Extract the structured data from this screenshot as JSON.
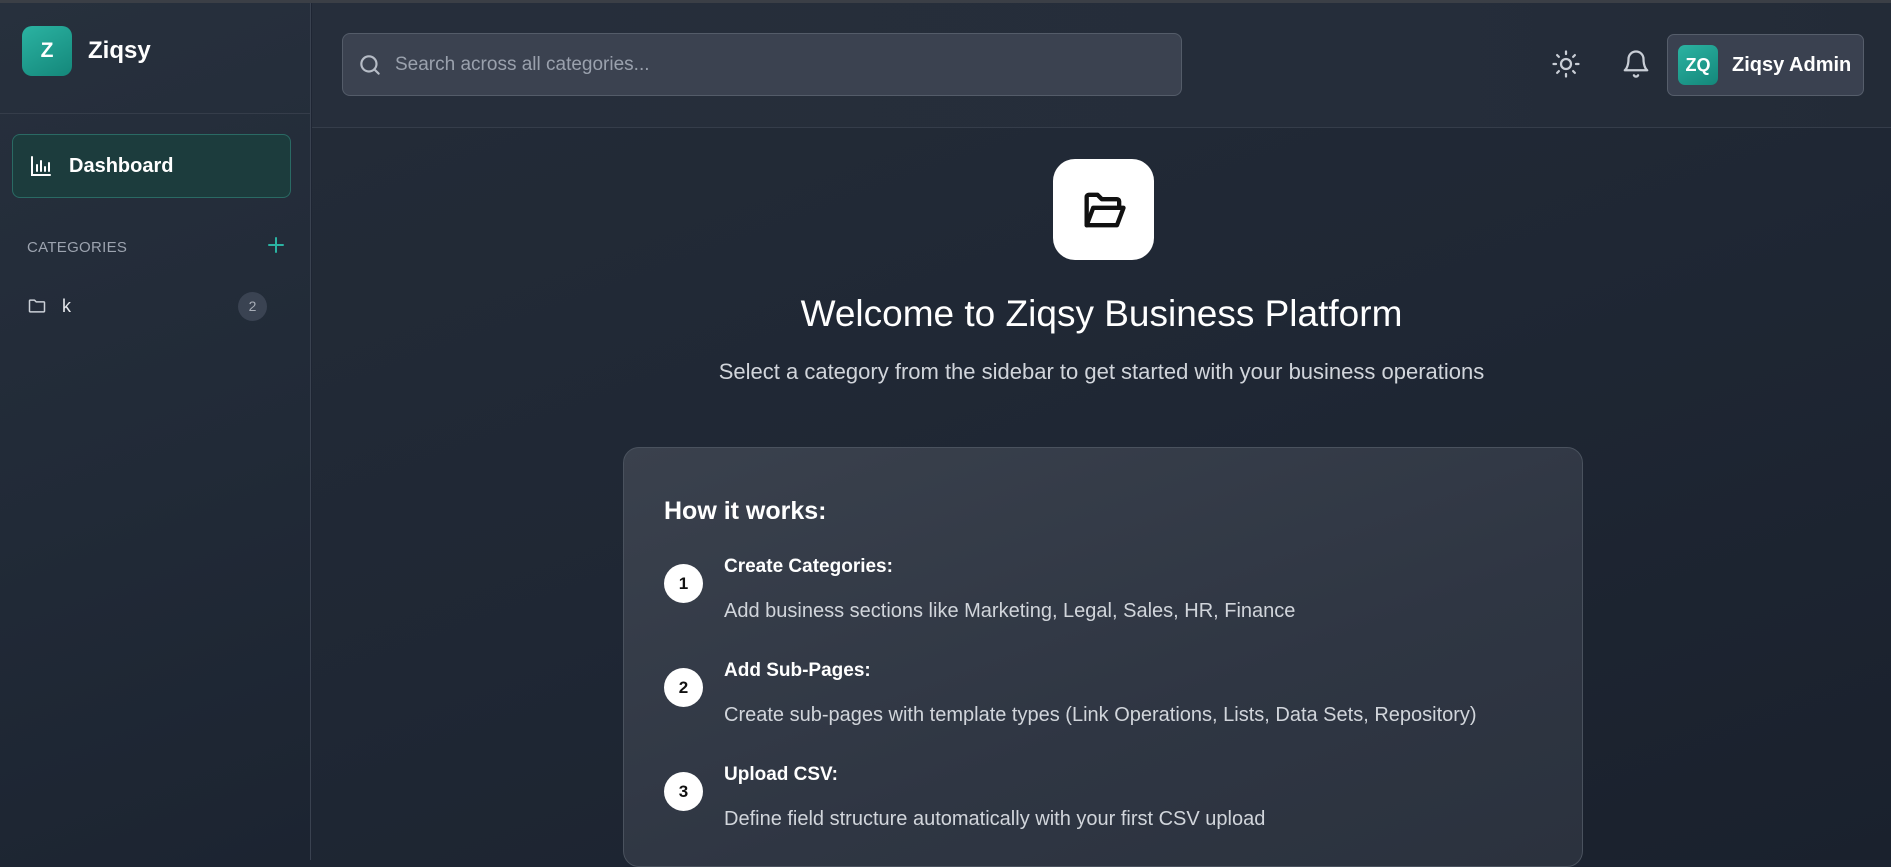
{
  "brand": {
    "logo_letter": "Z",
    "name": "Ziqsy"
  },
  "nav": {
    "dashboard_label": "Dashboard"
  },
  "categories": {
    "title": "CATEGORIES",
    "add_icon": "plus-icon",
    "items": [
      {
        "label": "k",
        "count": "2",
        "icon": "folder-icon"
      }
    ]
  },
  "header": {
    "search_placeholder": "Search across all categories...",
    "theme_icon": "sun-icon",
    "notification_icon": "bell-icon",
    "user": {
      "initials": "ZQ",
      "name": "Ziqsy Admin"
    }
  },
  "welcome": {
    "icon": "folder-open-icon",
    "title": "Welcome to Ziqsy Business Platform",
    "subtitle": "Select a category from the sidebar to get started with your business operations"
  },
  "how_it_works": {
    "title": "How it works:",
    "steps": [
      {
        "num": "1",
        "title": "Create Categories:",
        "desc": "Add business sections like Marketing, Legal, Sales, HR, Finance"
      },
      {
        "num": "2",
        "title": "Add Sub-Pages:",
        "desc": "Create sub-pages with template types (Link Operations, Lists, Data Sets, Repository)"
      },
      {
        "num": "3",
        "title": "Upload CSV:",
        "desc": "Define field structure automatically with your first CSV upload"
      }
    ]
  },
  "colors": {
    "accent": "#2bb3a2",
    "background": "#1e2533",
    "card": "#343b47"
  }
}
